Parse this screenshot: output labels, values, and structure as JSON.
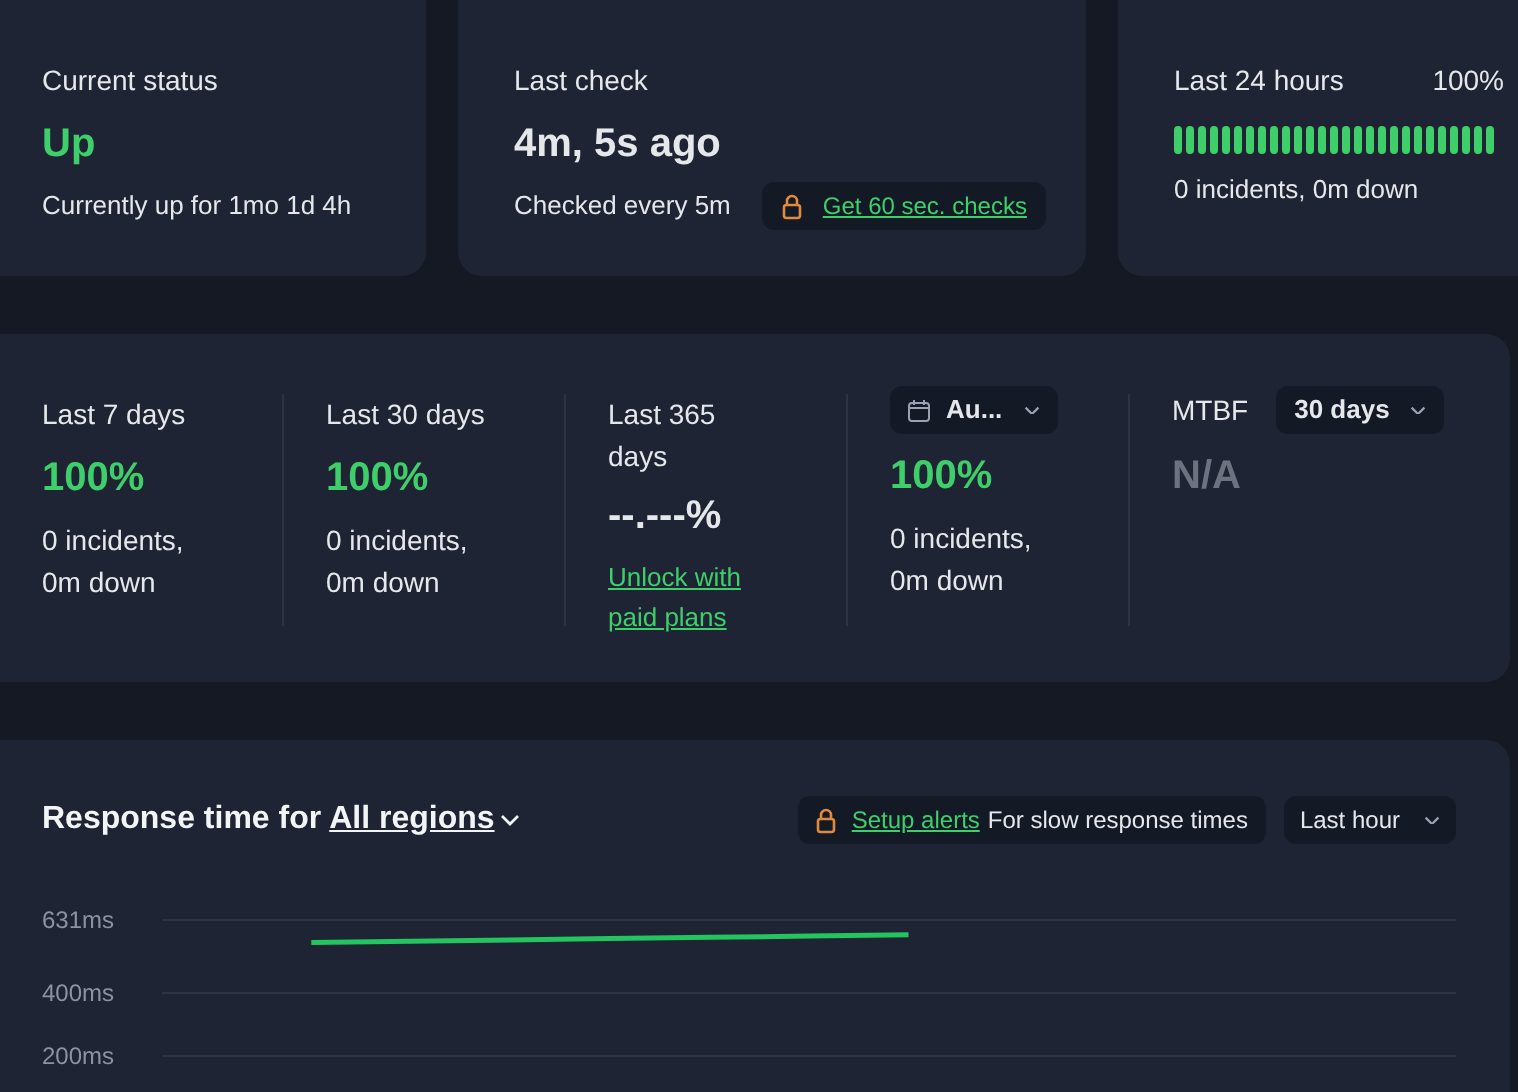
{
  "status_card": {
    "label": "Current status",
    "value": "Up",
    "detail": "Currently up for 1mo 1d 4h"
  },
  "last_check_card": {
    "label": "Last check",
    "value": "4m, 5s ago",
    "detail": "Checked every 5m",
    "upgrade_link": "Get 60 sec. checks"
  },
  "last_24h_card": {
    "label": "Last 24 hours",
    "percent": "100%",
    "detail": "0 incidents, 0m down"
  },
  "uptime_stats": [
    {
      "kind": "label",
      "label": "Last 7 days",
      "value": "100%",
      "detail_lines": [
        "0 incidents,",
        "0m down"
      ]
    },
    {
      "kind": "label",
      "label": "Last 30 days",
      "value": "100%",
      "detail_lines": [
        "0 incidents,",
        "0m down"
      ]
    },
    {
      "kind": "locked",
      "label_lines": [
        "Last 365",
        "days"
      ],
      "value": "--.---%",
      "link_lines": [
        "Unlock with",
        "paid plans"
      ]
    },
    {
      "kind": "picker",
      "picker": "Au...",
      "value": "100%",
      "detail_lines": [
        "0 incidents,",
        "0m down"
      ]
    },
    {
      "kind": "mtbf",
      "label": "MTBF",
      "picker": "30 days",
      "value": "N/A"
    }
  ],
  "response_time": {
    "title": "Response time for",
    "region": "All regions",
    "alert_link": "Setup alerts",
    "alert_text": "For slow response times",
    "range": "Last hour",
    "chart_data": {
      "type": "line",
      "categories": [
        null,
        null,
        null,
        null,
        null,
        null,
        null,
        null,
        null,
        null,
        null,
        null,
        null
      ],
      "ylim": [
        200,
        631
      ],
      "yticks": [
        {
          "value": 200,
          "label": "200ms"
        },
        {
          "value": 400,
          "label": "400ms"
        },
        {
          "value": 631,
          "label": "631ms"
        }
      ],
      "series": [
        {
          "color": "#22c55e",
          "values": [
            null,
            560,
            564,
            568,
            572,
            576,
            580,
            584,
            null,
            null,
            null,
            null,
            null
          ]
        }
      ]
    }
  }
}
